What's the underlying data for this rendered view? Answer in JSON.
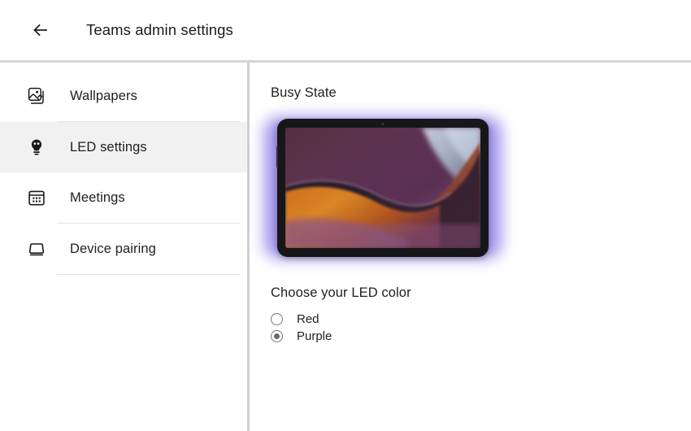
{
  "header": {
    "back_icon": "arrow-left-icon",
    "title": "Teams admin settings"
  },
  "sidebar": {
    "items": [
      {
        "label": "Wallpapers",
        "icon": "image-icon",
        "selected": false
      },
      {
        "label": "LED settings",
        "icon": "lightbulb-icon",
        "selected": true
      },
      {
        "label": "Meetings",
        "icon": "calendar-icon",
        "selected": false
      },
      {
        "label": "Device pairing",
        "icon": "monitor-icon",
        "selected": false
      }
    ]
  },
  "main": {
    "section_title": "Busy State",
    "device": {
      "name": "tablet-preview",
      "led_glow_color": "#8f7fe8",
      "bezel_color": "#17171a"
    },
    "choose_title": "Choose your LED color",
    "color_options": [
      {
        "label": "Red",
        "selected": false,
        "swatch": "#d93025"
      },
      {
        "label": "Purple",
        "selected": true,
        "swatch": "#8f7fe8"
      }
    ]
  }
}
